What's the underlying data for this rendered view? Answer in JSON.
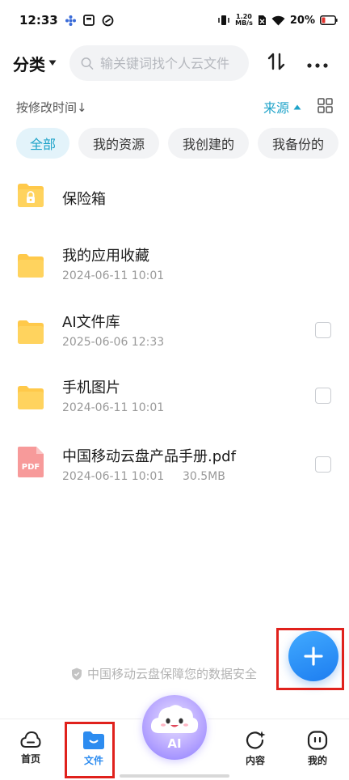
{
  "status_bar": {
    "time": "12:33",
    "net_speed_value": "1.20",
    "net_speed_unit": "MB/s",
    "battery": "20%"
  },
  "header": {
    "category_label": "分类",
    "search_placeholder": "输关键词找个人云文件"
  },
  "sort_bar": {
    "sort_label": "按修改时间",
    "sort_arrow": "↓",
    "source_label": "来源"
  },
  "filters": [
    {
      "label": "全部",
      "active": true
    },
    {
      "label": "我的资源",
      "active": false
    },
    {
      "label": "我创建的",
      "active": false
    },
    {
      "label": "我备份的",
      "active": false
    }
  ],
  "files": [
    {
      "name": "保险箱",
      "type": "safe"
    },
    {
      "name": "我的应用收藏",
      "date": "2024-06-11 10:01",
      "type": "folder"
    },
    {
      "name": "AI文件库",
      "date": "2025-06-06 12:33",
      "type": "folder"
    },
    {
      "name": "手机图片",
      "date": "2024-06-11 10:01",
      "type": "folder"
    },
    {
      "name": "中国移动云盘产品手册.pdf",
      "date": "2024-06-11 10:01",
      "size": "30.5MB",
      "type": "pdf",
      "icon_text": "PDF"
    }
  ],
  "footer_note": "中国移动云盘保障您的数据安全",
  "bottom_nav": {
    "home": "首页",
    "files": "文件",
    "ai": "AI",
    "content": "内容",
    "mine": "我的"
  },
  "colors": {
    "accent": "#1fa3c9",
    "nav_active": "#2d8cf0",
    "highlight": "#e0211c",
    "folder": "#ffc94a"
  }
}
